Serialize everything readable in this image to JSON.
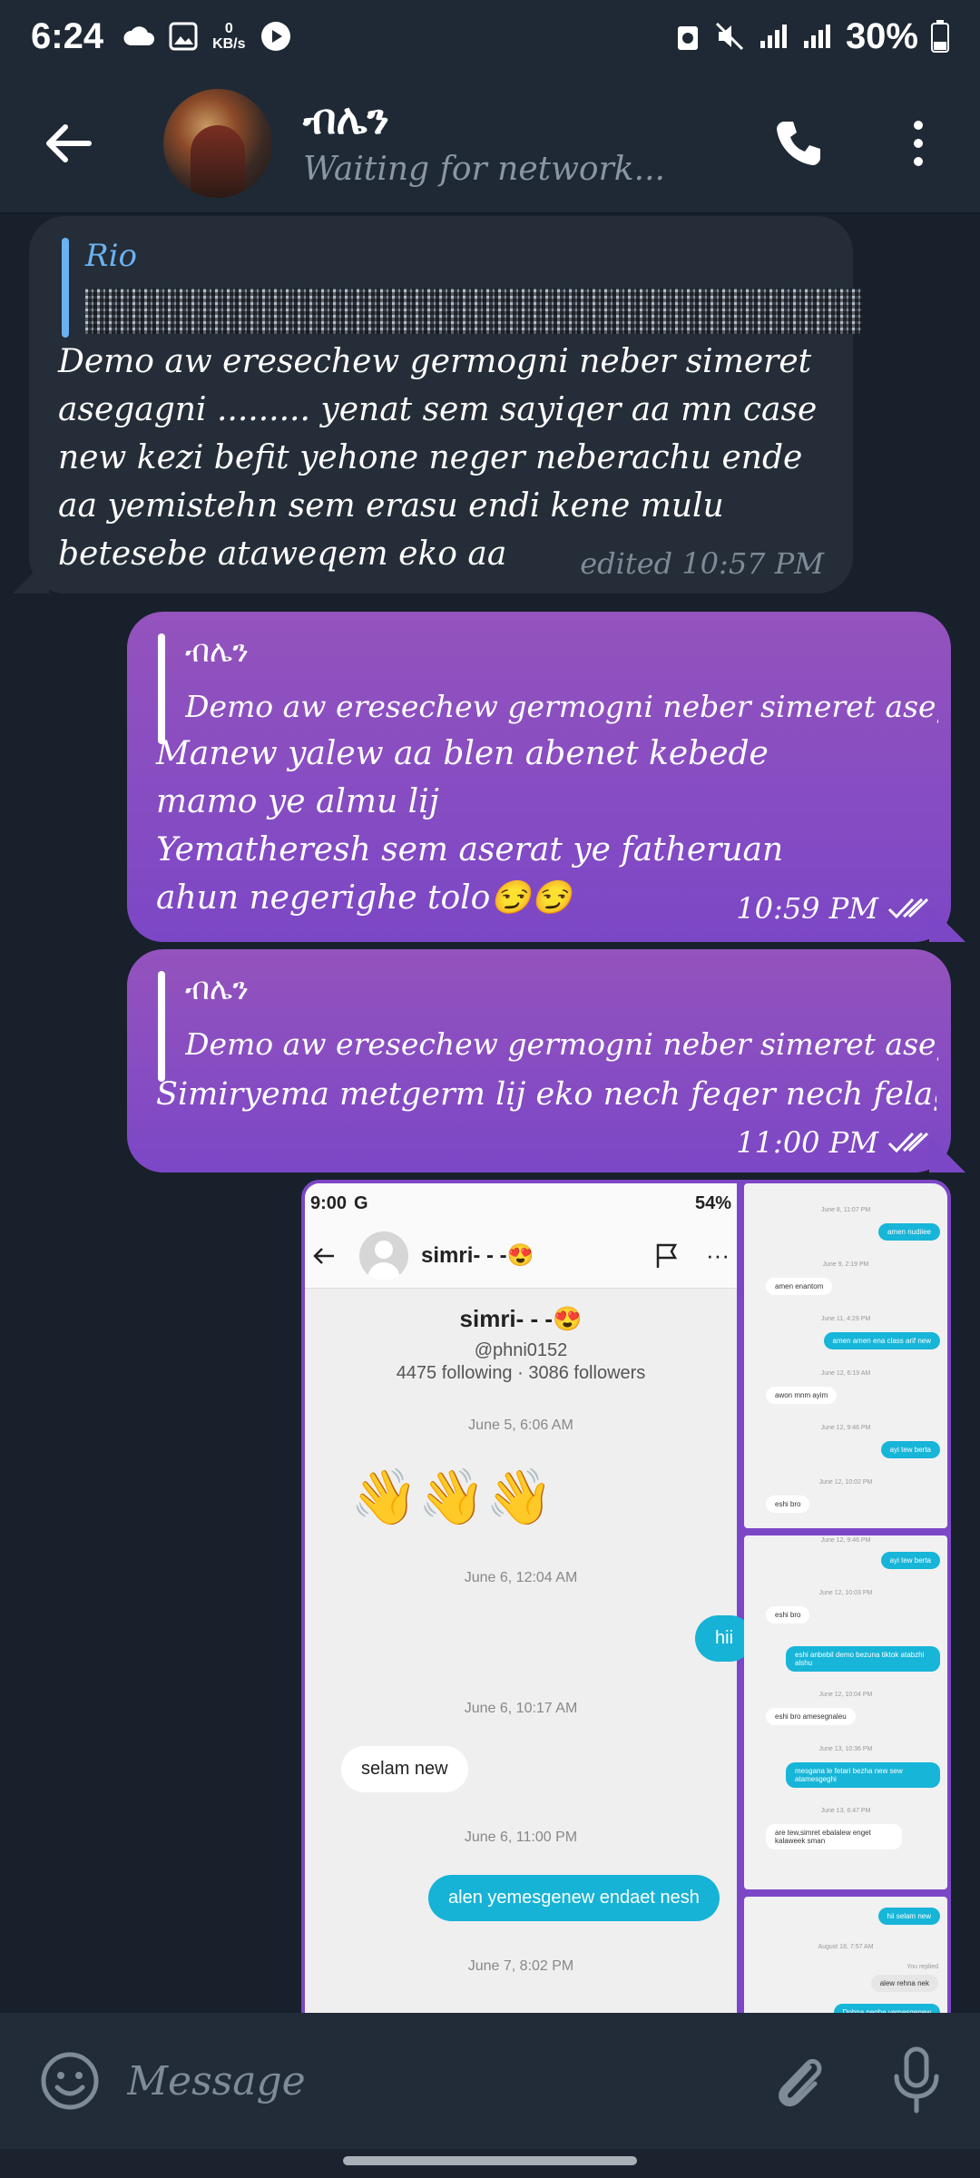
{
  "status_bar": {
    "time": "6:24",
    "net_speed_value": "0",
    "net_speed_unit": "KB/s",
    "battery": "30%"
  },
  "header": {
    "contact_name": "ብሌን",
    "status": "Waiting for network..."
  },
  "messages": [
    {
      "direction": "incoming",
      "reply_to_name": "Rio",
      "text": "Demo aw eresechew germogni neber simeret asegagni ......... yenat sem sayiqer aa mn case new kezi befit yehone neger neberachu ende aa yemistehn sem erasu endi kene mulu betesebe ataweqem eko aa",
      "meta": "edited 10:57 PM"
    },
    {
      "direction": "outgoing",
      "reply_to_name": "ብሌን",
      "reply_preview": "Demo aw eresechew germogni neber simeret asegagni .....",
      "text": "Manew yalew aa blen abenet kebede mamo ye almu lij\nYematheresh sem aserat ye fatheruan ahun negerighe tolo😏😏",
      "time": "10:59 PM"
    },
    {
      "direction": "outgoing",
      "reply_to_name": "ብሌን",
      "reply_preview": "Demo aw eresechew germogni neber simeret asegagni .....",
      "text": "Simiryema metgerm lij eko nech feqer nech felagiye",
      "time": "11:00 PM"
    }
  ],
  "screenshot_main": {
    "status_time": "9:00",
    "status_g": "G",
    "battery": "54%",
    "profile_name": "simri- - -😍",
    "handle": "@phni0152",
    "stats": "4475 following · 3086 followers",
    "waves": "👋👋👋",
    "stamps": [
      "June 5, 6:06 AM",
      "June 6, 12:04 AM",
      "June 6, 10:17 AM",
      "June 6, 11:00 PM",
      "June 7, 8:02 PM"
    ],
    "msg_hii": "hii",
    "msg_selam": "selam new",
    "msg_alen": "alen yemesgenew endaet nesh"
  },
  "screenshot_small_1": {
    "stamps": [
      "June 8, 11:07 PM",
      "June 9, 2:19 PM",
      "June 11, 4:29 PM",
      "June 12, 6:19 AM",
      "June 12, 9:46 PM",
      "June 12, 10:02 PM"
    ],
    "out": [
      "amen nudiiee",
      "amen amen ena class arif new",
      "ayi tew berta"
    ],
    "in": [
      "amen enantom",
      "awon mnm ayim",
      "eshi bro"
    ]
  },
  "screenshot_small_2": {
    "stamps": [
      "June 12, 9:46 PM",
      "June 12, 10:03 PM",
      "June 12, 10:04 PM",
      "June 13, 10:36 PM",
      "June 13, 6:47 PM"
    ],
    "out": [
      "ayi tew berta",
      "eshi anbebil demo bezuna tiktok atabzhi alshu",
      "mesgana le fetari bezha new sew atamesgeghi"
    ],
    "in": [
      "eshi bro",
      "eshi bro amesegnaleu",
      "are tew,simret ebalalew enget kalaweek sman"
    ]
  },
  "screenshot_small_3": {
    "stamps": [
      "August 18, 7:57 AM",
      "You replied"
    ],
    "out": [
      "hii selam new",
      "Dohna neghe yemesgenew"
    ],
    "in": [
      "alew rehna nek"
    ]
  },
  "input": {
    "placeholder": "Message"
  },
  "colors": {
    "incoming_bubble": "#242d38",
    "outgoing_bubble": "#7c47c6",
    "reply_bar_in": "#6bb2f0",
    "background": "#17202b"
  }
}
